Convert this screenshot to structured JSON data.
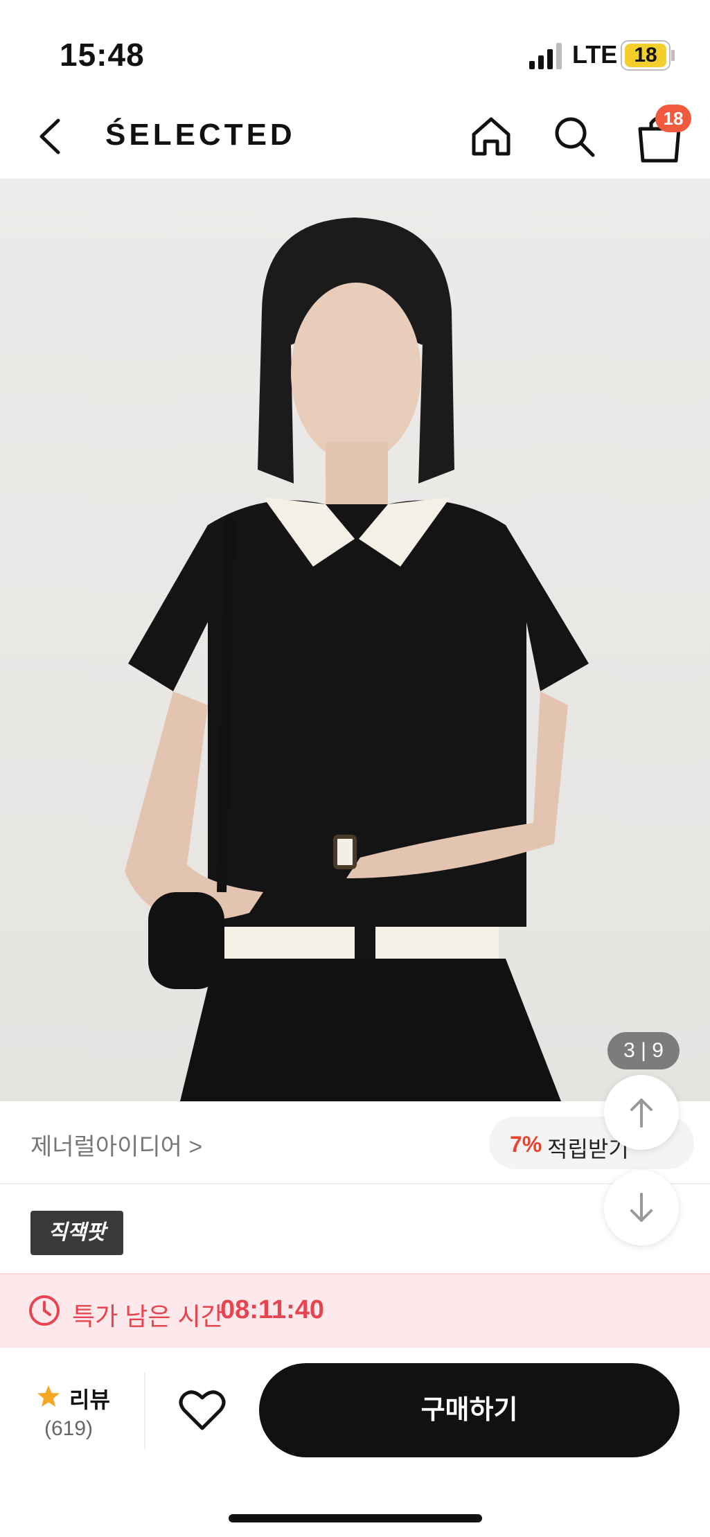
{
  "status_bar": {
    "time": "15:48",
    "network": "LTE",
    "battery": "18"
  },
  "nav": {
    "brand": "ŚELECTED",
    "cart_count": "18"
  },
  "product": {
    "image_counter": "3 | 9",
    "brand_link": "제너럴아이디어 >",
    "reward_percent": "7%",
    "reward_label": "적립받기",
    "tag": "직잭팟"
  },
  "deal": {
    "label": "특가 남은 시간",
    "time": "08:11:40"
  },
  "bottom": {
    "review_label": "리뷰",
    "review_count": "(619)",
    "buy_label": "구매하기"
  },
  "colors": {
    "accent": "#e8444f",
    "badge": "#f25a3e",
    "buy_button": "#111111"
  },
  "icons": [
    "back-icon",
    "home-icon",
    "search-icon",
    "shopping-bag-icon",
    "clock-icon",
    "star-icon",
    "heart-icon",
    "arrow-up-icon",
    "arrow-down-icon"
  ]
}
